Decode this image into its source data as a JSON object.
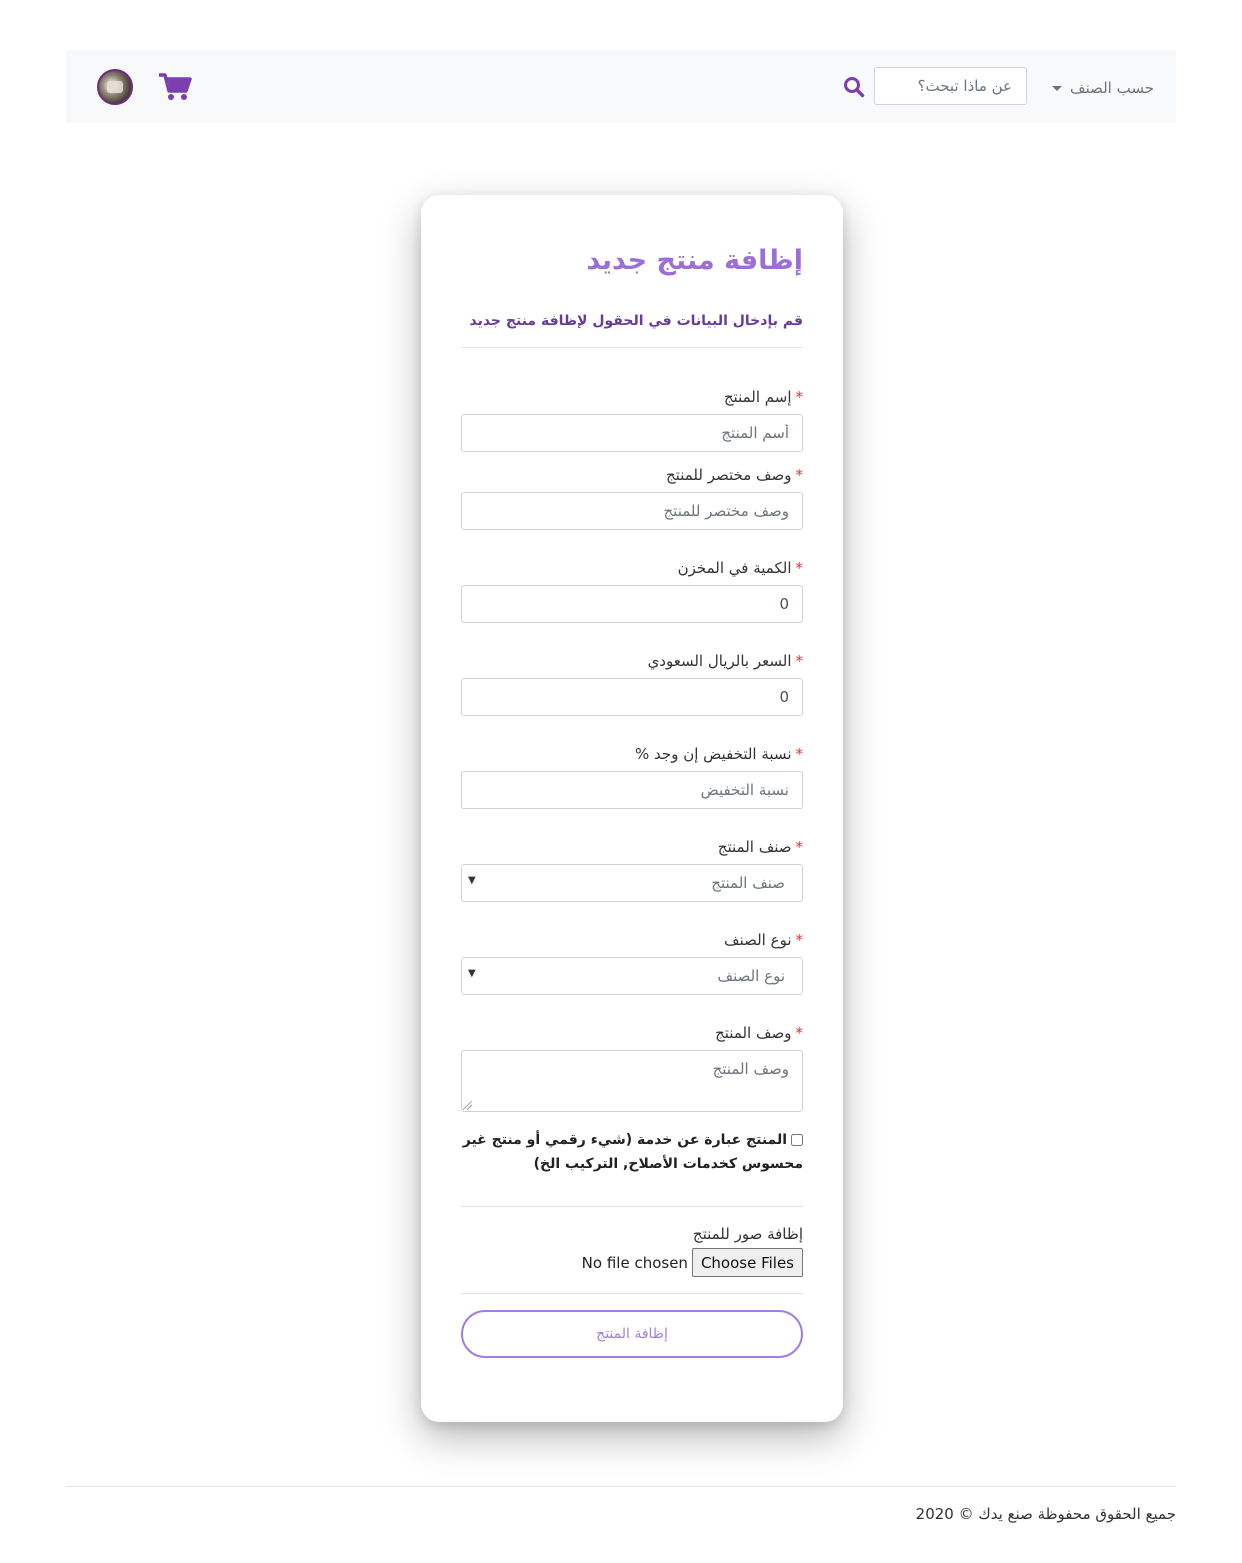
{
  "navbar": {
    "category_dropdown_label": "حسب الصنف",
    "search_placeholder": "عن ماذا تبحث؟",
    "accent_color": "#7b3fb0"
  },
  "form": {
    "title": "إظافة منتج جديد",
    "subtitle": "قم بإدخال البيانات في الحقول لإظافة منتج جديد",
    "required_marker": "*",
    "fields": {
      "name": {
        "label": "إسم المنتج",
        "placeholder": "أسم المنتج",
        "value": ""
      },
      "short_description": {
        "label": "وصف مختصر للمنتج",
        "placeholder": "وصف مختصر للمنتج",
        "value": ""
      },
      "stock_quantity": {
        "label": "الكمية في المخزن",
        "value": "0"
      },
      "price": {
        "label": "السعر بالريال السعودي",
        "value": "0"
      },
      "discount": {
        "label": "نسبة التخفيض إن وجد %",
        "placeholder": "نسبة التخفيض",
        "value": ""
      },
      "category": {
        "label": "صنف المنتج",
        "selected": "صنف المنتج",
        "arrow": "▼"
      },
      "category_type": {
        "label": "نوع الصنف",
        "selected": "نوع الصنف",
        "arrow": "▼"
      },
      "description": {
        "label": "وصف المنتج",
        "placeholder": "وصف المنتج",
        "value": ""
      }
    },
    "service_checkbox": {
      "label": "المنتج عبارة عن خدمة (شيء رقمي أو منتج غير محسوس كخدمات الأصلاح, التركيب الخ)",
      "checked": false
    },
    "images": {
      "label": "إظافة صور للمنتج",
      "status": "No file chosen",
      "button_label": "Choose Files"
    },
    "submit_label": "إظافة المنتج"
  },
  "footer": {
    "copyright": "جميع الحقوق محفوظة صنع يدك © 2020"
  }
}
